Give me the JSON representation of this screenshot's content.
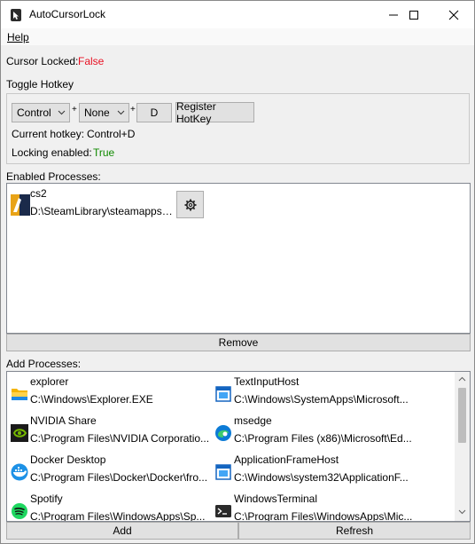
{
  "window": {
    "title": "AutoCursorLock"
  },
  "menu": {
    "help": "Help"
  },
  "status": {
    "cursor_locked_label": "Cursor Locked:",
    "cursor_locked_value": "False"
  },
  "hotkey": {
    "group_label": "Toggle Hotkey",
    "modifier1": "Control",
    "modifier2": "None",
    "plus": "+",
    "key": "D",
    "register_label": "Register HotKey",
    "current_label": "Current hotkey:",
    "current_value": "Control+D",
    "locking_label": "Locking enabled:",
    "locking_value": "True"
  },
  "enabled": {
    "label": "Enabled Processes:",
    "items": [
      {
        "name": "cs2",
        "path": "D:\\SteamLibrary\\steamapps\\..."
      }
    ],
    "remove_label": "Remove"
  },
  "add": {
    "label": "Add Processes:",
    "items": [
      {
        "name": "explorer",
        "path": "C:\\Windows\\Explorer.EXE",
        "icon": "folder-icon"
      },
      {
        "name": "TextInputHost",
        "path": "C:\\Windows\\SystemApps\\Microsoft...",
        "icon": "window-app-icon"
      },
      {
        "name": "NVIDIA Share",
        "path": "C:\\Program Files\\NVIDIA Corporatio...",
        "icon": "nvidia-icon"
      },
      {
        "name": "msedge",
        "path": "C:\\Program Files (x86)\\Microsoft\\Ed...",
        "icon": "edge-icon"
      },
      {
        "name": "Docker Desktop",
        "path": "C:\\Program Files\\Docker\\Docker\\fro...",
        "icon": "docker-icon"
      },
      {
        "name": "ApplicationFrameHost",
        "path": "C:\\Windows\\system32\\ApplicationF...",
        "icon": "window-app-icon"
      },
      {
        "name": "Spotify",
        "path": "C:\\Program Files\\WindowsApps\\Sp...",
        "icon": "spotify-icon"
      },
      {
        "name": "WindowsTerminal",
        "path": "C:\\Program Files\\WindowsApps\\Mic...",
        "icon": "terminal-icon"
      }
    ],
    "add_label": "Add",
    "refresh_label": "Refresh"
  }
}
